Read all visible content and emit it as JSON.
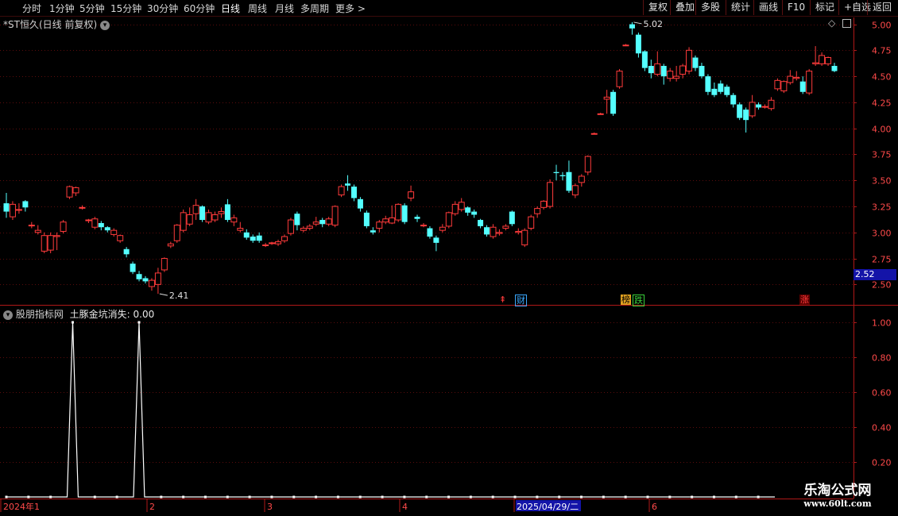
{
  "toolbar": {
    "periods": [
      "分时",
      "1分钟",
      "5分钟",
      "15分钟",
      "30分钟",
      "60分钟",
      "日线",
      "周线",
      "月线",
      "多周期",
      "更多 >"
    ],
    "active_period": "日线",
    "actions": [
      "复权",
      "叠加",
      "多股",
      "统计",
      "画线",
      "F10",
      "标记",
      "+自选",
      "返回"
    ]
  },
  "main_title": "*ST恒久(日线 前复权)",
  "indicator_title": "股朋指标网",
  "indicator_label": "土豚金坑消失: 0.00",
  "current_price_tag": "2.52",
  "watermark": {
    "name": "乐淘公式网",
    "url": "www.60lt.com"
  },
  "markers": [
    {
      "symbol": "⇞",
      "color": "#ff3b3b"
    },
    {
      "symbol": "财",
      "color": "#3aa8ff"
    },
    {
      "symbol": "榜",
      "color": "#e0a020"
    },
    {
      "symbol": "跌",
      "color": "#3ad13a"
    },
    {
      "symbol": "涨",
      "color": "#ff3b3b"
    }
  ],
  "date_axis": [
    "2024年1",
    "2",
    "3",
    "4",
    "2025/04/29/二",
    "6"
  ],
  "colors": {
    "up": "#ff3b3b",
    "down": "#54ffff",
    "grid": "#5a0c0c",
    "axis": "#b01818",
    "bg": "#000000"
  },
  "chart_data": [
    {
      "type": "candlestick",
      "y_ticks": [
        5.0,
        4.75,
        4.5,
        4.25,
        4.0,
        3.75,
        3.5,
        3.25,
        3.0,
        2.75,
        2.5
      ],
      "ylim": [
        2.35,
        5.05
      ],
      "annotations": [
        {
          "text": "5.02",
          "value": 5.02
        },
        {
          "text": "2.41",
          "value": 2.41
        }
      ],
      "candles": [
        [
          3.28,
          3.2,
          3.38,
          3.14
        ],
        [
          3.15,
          3.27,
          3.3,
          3.12
        ],
        [
          3.22,
          3.22,
          3.28,
          3.18
        ],
        [
          3.3,
          3.24,
          3.31,
          3.2
        ],
        [
          3.07,
          3.07,
          3.1,
          3.04
        ],
        [
          3.0,
          3.02,
          3.07,
          2.98
        ],
        [
          2.82,
          2.97,
          3.0,
          2.8
        ],
        [
          2.83,
          2.97,
          3.0,
          2.8
        ],
        [
          2.96,
          2.97,
          3.0,
          2.83
        ],
        [
          3.01,
          3.1,
          3.12,
          2.99
        ],
        [
          3.34,
          3.44,
          3.45,
          3.32
        ],
        [
          3.38,
          3.43,
          3.44,
          3.35
        ],
        [
          3.24,
          3.24,
          3.26,
          3.22
        ],
        [
          3.12,
          3.12,
          3.13,
          3.09
        ],
        [
          3.05,
          3.13,
          3.15,
          3.03
        ],
        [
          3.09,
          3.05,
          3.11,
          3.02
        ],
        [
          3.05,
          3.02,
          3.06,
          3.0
        ],
        [
          2.98,
          3.02,
          3.04,
          2.96
        ],
        [
          2.92,
          2.97,
          2.98,
          2.9
        ],
        [
          2.84,
          2.79,
          2.86,
          2.76
        ],
        [
          2.7,
          2.62,
          2.72,
          2.6
        ],
        [
          2.6,
          2.55,
          2.63,
          2.53
        ],
        [
          2.56,
          2.53,
          2.58,
          2.51
        ],
        [
          2.48,
          2.54,
          2.56,
          2.44
        ],
        [
          2.5,
          2.61,
          2.66,
          2.41
        ],
        [
          2.64,
          2.75,
          2.76,
          2.62
        ],
        [
          2.87,
          2.89,
          2.91,
          2.85
        ],
        [
          2.92,
          3.07,
          3.08,
          2.9
        ],
        [
          3.02,
          3.19,
          3.22,
          3.0
        ],
        [
          3.08,
          3.17,
          3.24,
          3.06
        ],
        [
          3.18,
          3.26,
          3.32,
          3.12
        ],
        [
          3.25,
          3.12,
          3.26,
          3.1
        ],
        [
          3.1,
          3.19,
          3.22,
          3.08
        ],
        [
          3.12,
          3.17,
          3.2,
          3.1
        ],
        [
          3.18,
          3.2,
          3.24,
          3.14
        ],
        [
          3.27,
          3.12,
          3.32,
          3.1
        ],
        [
          3.1,
          3.14,
          3.17,
          3.06
        ],
        [
          3.02,
          3.04,
          3.1,
          3.0
        ],
        [
          3.0,
          2.95,
          3.03,
          2.93
        ],
        [
          2.96,
          2.92,
          2.98,
          2.9
        ],
        [
          2.97,
          2.92,
          3.0,
          2.9
        ],
        [
          2.88,
          2.88,
          2.9,
          2.86
        ],
        [
          2.9,
          2.9,
          2.91,
          2.88
        ],
        [
          2.89,
          2.91,
          2.93,
          2.87
        ],
        [
          2.92,
          2.96,
          2.98,
          2.9
        ],
        [
          2.99,
          3.12,
          3.14,
          2.97
        ],
        [
          3.18,
          3.07,
          3.2,
          3.02
        ],
        [
          3.02,
          3.04,
          3.06,
          3.0
        ],
        [
          3.04,
          3.06,
          3.08,
          3.02
        ],
        [
          3.08,
          3.1,
          3.15,
          3.06
        ],
        [
          3.12,
          3.08,
          3.14,
          3.05
        ],
        [
          3.08,
          3.13,
          3.15,
          3.06
        ],
        [
          3.07,
          3.25,
          3.26,
          3.05
        ],
        [
          3.36,
          3.44,
          3.46,
          3.34
        ],
        [
          3.47,
          3.45,
          3.55,
          3.4
        ],
        [
          3.44,
          3.33,
          3.46,
          3.3
        ],
        [
          3.32,
          3.23,
          3.34,
          3.2
        ],
        [
          3.19,
          3.06,
          3.21,
          3.04
        ],
        [
          3.02,
          3.0,
          3.05,
          2.98
        ],
        [
          3.04,
          3.1,
          3.12,
          3.0
        ],
        [
          3.1,
          3.13,
          3.16,
          3.08
        ],
        [
          3.09,
          3.14,
          3.26,
          3.08
        ],
        [
          3.12,
          3.27,
          3.28,
          3.1
        ],
        [
          3.26,
          3.1,
          3.28,
          3.08
        ],
        [
          3.33,
          3.39,
          3.45,
          3.3
        ],
        [
          3.15,
          3.13,
          3.17,
          3.1
        ],
        [
          3.07,
          3.07,
          3.09,
          3.05
        ],
        [
          3.04,
          2.96,
          3.06,
          2.94
        ],
        [
          2.95,
          2.9,
          2.97,
          2.82
        ],
        [
          3.02,
          3.05,
          3.08,
          3.0
        ],
        [
          3.06,
          3.19,
          3.2,
          3.04
        ],
        [
          3.18,
          3.27,
          3.3,
          3.16
        ],
        [
          3.22,
          3.29,
          3.33,
          3.2
        ],
        [
          3.24,
          3.19,
          3.25,
          3.16
        ],
        [
          3.2,
          3.17,
          3.22,
          3.14
        ],
        [
          3.12,
          3.06,
          3.13,
          3.04
        ],
        [
          3.05,
          2.98,
          3.07,
          2.96
        ],
        [
          2.96,
          3.05,
          3.08,
          2.94
        ],
        [
          2.99,
          3.0,
          3.03,
          2.97
        ],
        [
          3.04,
          3.06,
          3.08,
          3.02
        ],
        [
          3.2,
          3.08,
          3.21,
          3.06
        ],
        [
          3.0,
          3.01,
          3.04,
          2.98
        ],
        [
          2.88,
          3.02,
          3.04,
          2.86
        ],
        [
          3.04,
          3.15,
          3.17,
          3.02
        ],
        [
          3.18,
          3.23,
          3.25,
          3.14
        ],
        [
          3.24,
          3.3,
          3.31,
          3.22
        ],
        [
          3.25,
          3.48,
          3.51,
          3.23
        ],
        [
          3.58,
          3.57,
          3.65,
          3.5
        ],
        [
          3.55,
          3.54,
          3.58,
          3.5
        ],
        [
          3.58,
          3.4,
          3.69,
          3.38
        ],
        [
          3.36,
          3.45,
          3.47,
          3.33
        ],
        [
          3.48,
          3.54,
          3.56,
          3.44
        ],
        [
          3.58,
          3.73,
          3.74,
          3.55
        ],
        [
          3.95,
          3.95,
          3.96,
          3.94
        ],
        [
          4.14,
          4.14,
          4.15,
          4.13
        ],
        [
          4.28,
          4.3,
          4.37,
          4.14
        ],
        [
          4.35,
          4.14,
          4.37,
          4.12
        ],
        [
          4.4,
          4.55,
          4.57,
          4.38
        ],
        [
          4.8,
          4.8,
          4.81,
          4.79
        ],
        [
          5.0,
          4.96,
          5.02,
          4.9
        ],
        [
          4.9,
          4.72,
          4.92,
          4.68
        ],
        [
          4.74,
          4.58,
          4.75,
          4.55
        ],
        [
          4.6,
          4.53,
          4.66,
          4.48
        ],
        [
          4.52,
          4.62,
          4.74,
          4.5
        ],
        [
          4.6,
          4.5,
          4.62,
          4.42
        ],
        [
          4.48,
          4.55,
          4.58,
          4.45
        ],
        [
          4.48,
          4.5,
          4.6,
          4.45
        ],
        [
          4.52,
          4.6,
          4.62,
          4.48
        ],
        [
          4.55,
          4.75,
          4.78,
          4.52
        ],
        [
          4.68,
          4.58,
          4.7,
          4.55
        ],
        [
          4.6,
          4.5,
          4.63,
          4.48
        ],
        [
          4.5,
          4.35,
          4.52,
          4.32
        ],
        [
          4.38,
          4.32,
          4.44,
          4.3
        ],
        [
          4.43,
          4.35,
          4.46,
          4.33
        ],
        [
          4.4,
          4.32,
          4.42,
          4.3
        ],
        [
          4.32,
          4.23,
          4.34,
          4.2
        ],
        [
          4.23,
          4.1,
          4.25,
          4.08
        ],
        [
          4.18,
          4.08,
          4.2,
          3.96
        ],
        [
          4.12,
          4.25,
          4.32,
          4.1
        ],
        [
          4.23,
          4.2,
          4.25,
          4.18
        ],
        [
          4.21,
          4.21,
          4.23,
          4.19
        ],
        [
          4.19,
          4.27,
          4.3,
          4.17
        ],
        [
          4.38,
          4.46,
          4.48,
          4.36
        ],
        [
          4.36,
          4.45,
          4.46,
          4.34
        ],
        [
          4.44,
          4.5,
          4.56,
          4.42
        ],
        [
          4.48,
          4.49,
          4.55,
          4.46
        ],
        [
          4.45,
          4.35,
          4.5,
          4.33
        ],
        [
          4.34,
          4.55,
          4.57,
          4.32
        ],
        [
          4.62,
          4.63,
          4.79,
          4.6
        ],
        [
          4.62,
          4.7,
          4.73,
          4.6
        ],
        [
          4.62,
          4.68,
          4.69,
          4.6
        ],
        [
          4.6,
          4.55,
          4.63,
          4.54
        ]
      ]
    },
    {
      "type": "line",
      "y_ticks": [
        1.0,
        0.8,
        0.6,
        0.4,
        0.2
      ],
      "ylim": [
        0,
        1.0
      ],
      "series": [
        {
          "values": [
            0,
            0,
            0,
            0,
            0,
            0,
            0,
            0,
            0,
            0,
            0,
            0,
            0,
            0,
            0,
            0,
            0,
            0,
            0,
            0,
            0,
            0,
            0,
            0,
            0,
            0,
            0,
            0,
            0,
            0,
            0,
            0,
            0,
            0,
            0,
            0,
            0,
            0,
            0,
            0,
            0,
            0,
            0,
            0,
            0,
            0,
            0,
            0,
            0,
            0,
            0,
            0,
            0,
            0,
            0,
            0,
            0,
            0,
            0,
            0,
            0,
            0,
            0,
            0,
            0,
            0,
            0,
            0,
            0,
            0,
            0,
            0,
            0,
            0,
            0,
            0,
            0,
            0,
            0,
            0,
            0,
            0,
            0,
            0,
            0,
            0,
            0,
            0,
            0,
            0,
            0,
            0,
            0,
            0,
            0,
            0,
            0,
            0,
            0,
            0,
            0,
            0,
            0,
            0,
            0,
            0,
            0,
            0,
            0,
            0,
            0,
            0,
            0,
            0,
            0,
            0,
            0,
            0,
            0,
            0,
            0,
            0,
            0,
            0,
            0,
            0,
            0,
            0,
            0,
            0,
            0,
            0,
            0,
            0,
            0,
            0,
            0,
            0,
            0,
            0
          ],
          "spikes": [
            12,
            24
          ]
        }
      ]
    }
  ]
}
